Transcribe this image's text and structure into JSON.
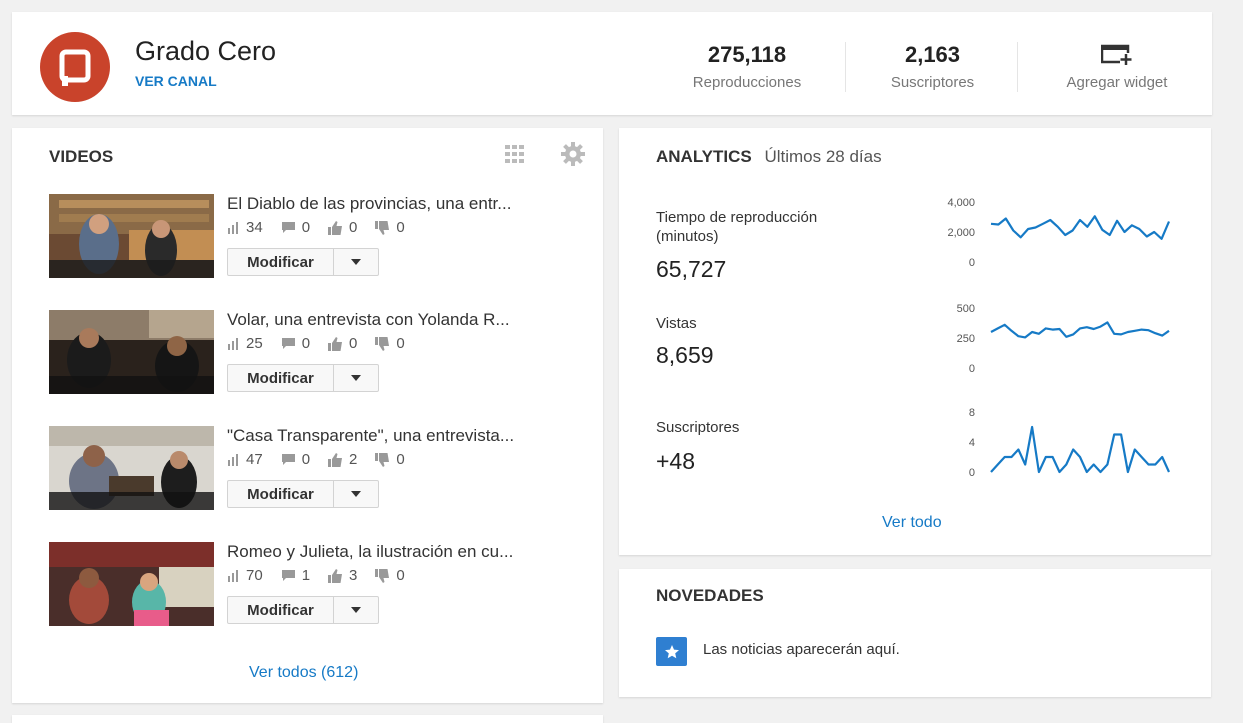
{
  "header": {
    "channel_name": "Grado Cero",
    "view_channel": "VER CANAL",
    "stats": [
      {
        "value": "275,118",
        "label": "Reproducciones"
      },
      {
        "value": "2,163",
        "label": "Suscriptores"
      }
    ],
    "widget_label": "Agregar widget"
  },
  "videos": {
    "title": "VIDEOS",
    "items": [
      {
        "title": "El Diablo de las provincias, una entr...",
        "views": "34",
        "comments": "0",
        "likes": "0",
        "dislikes": "0"
      },
      {
        "title": "Volar, una entrevista con Yolanda R...",
        "views": "25",
        "comments": "0",
        "likes": "0",
        "dislikes": "0"
      },
      {
        "title": "\"Casa Transparente\", una entrevista...",
        "views": "47",
        "comments": "0",
        "likes": "2",
        "dislikes": "0"
      },
      {
        "title": "Romeo y Julieta, la ilustración en cu...",
        "views": "70",
        "comments": "1",
        "likes": "3",
        "dislikes": "0"
      }
    ],
    "edit_label": "Modificar",
    "see_all": "Ver todos (612)"
  },
  "analytics": {
    "title": "ANALYTICS",
    "period": "Últimos 28 días",
    "metrics": [
      {
        "label_line1": "Tiempo de reproducción",
        "label_line2": "(minutos)",
        "value": "65,727"
      },
      {
        "label_line1": "Vistas",
        "value": "8,659"
      },
      {
        "label_line1": "Suscriptores",
        "value": "+48"
      }
    ],
    "see_all": "Ver todo"
  },
  "news": {
    "title": "NOVEDADES",
    "empty_text": "Las noticias aparecerán aquí."
  },
  "colors": {
    "accent": "#167ac6",
    "spark_line": "#167ac6",
    "logo_red": "#c9432b"
  },
  "chart_data": [
    {
      "type": "line",
      "series": [
        {
          "values": [
            2550,
            2500,
            2900,
            2100,
            1650,
            2200,
            2300,
            2550,
            2800,
            2350,
            1800,
            2100,
            2800,
            2350,
            3050,
            2150,
            1800,
            2750,
            2000,
            2450,
            2200,
            1700,
            2000,
            1550,
            2700
          ]
        }
      ],
      "yticks": [
        "4,000",
        "2,000",
        "0"
      ],
      "ylim": [
        0,
        4000
      ]
    },
    {
      "type": "line",
      "series": [
        {
          "values": [
            300,
            330,
            360,
            310,
            265,
            255,
            300,
            285,
            330,
            320,
            325,
            260,
            280,
            330,
            340,
            325,
            345,
            380,
            285,
            280,
            300,
            310,
            320,
            315,
            290,
            270,
            310
          ]
        }
      ],
      "yticks": [
        "500",
        "250",
        "0"
      ],
      "ylim": [
        0,
        500
      ]
    },
    {
      "type": "line",
      "series": [
        {
          "values": [
            0,
            1,
            2,
            2,
            3,
            1,
            6,
            0,
            2,
            2,
            0,
            1,
            3,
            2,
            0,
            1,
            0,
            1,
            5,
            5,
            0,
            3,
            2,
            1,
            1,
            2,
            0
          ]
        }
      ],
      "yticks": [
        "8",
        "4",
        "0"
      ],
      "ylim": [
        0,
        8
      ]
    }
  ]
}
